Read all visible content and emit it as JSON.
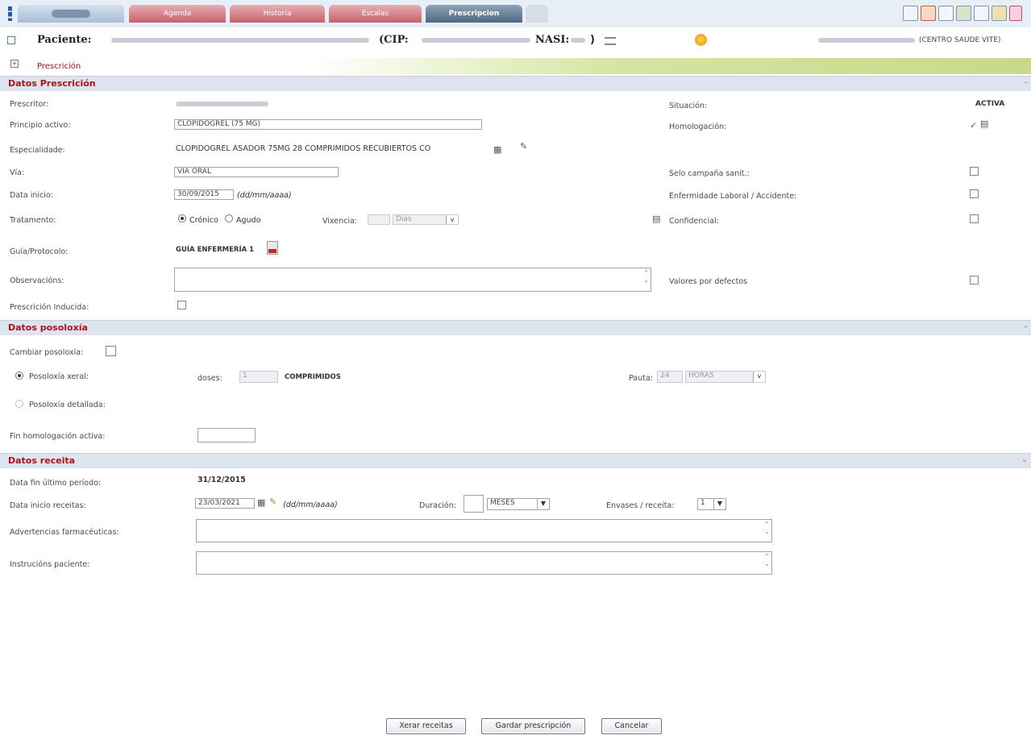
{
  "topbar": {
    "tabs": [
      {
        "label": "Agenda"
      },
      {
        "label": "Historia"
      },
      {
        "label": "Escalas"
      },
      {
        "label": "Prescripcion"
      }
    ]
  },
  "patient": {
    "label": "Paciente:",
    "cip_label": "(CIP:",
    "nasi_label": "NASI:",
    "close_paren": ")",
    "centre": "(CENTRO SAUDE VITE)"
  },
  "page_title": "Prescrición",
  "datos_prescricion": {
    "header": "Datos Prescrición",
    "prescritor_label": "Prescritor:",
    "situacion_label": "Situación:",
    "situacion_value": "ACTIVA",
    "principio_label": "Principio activo:",
    "principio_value": "CLOPIDOGREL (75 MG)",
    "homologacion_label": "Homologación:",
    "especialidade_label": "Especialidade:",
    "especialidade_value": "CLOPIDOGREL ASADOR 75MG 28 COMPRIMIDOS RECUBIERTOS CO",
    "via_label": "Vía:",
    "via_value": "VÍA ORAL",
    "selo_label": "Selo campaña sanit.:",
    "data_inicio_label": "Data inicio:",
    "data_inicio_value": "30/09/2015",
    "date_format_hint": "(dd/mm/aaaa)",
    "enfermidade_label": "Enfermidade Laboral / Accidente:",
    "tratamento_label": "Tratamento:",
    "cronico_label": "Crónico",
    "agudo_label": "Agudo",
    "vixencia_label": "Vixencia:",
    "vixencia_unit": "Días",
    "confidencial_label": "Confidencial:",
    "guia_label": "Guía/Protocolo:",
    "guia_value": "GUÍA ENFERMERÍA 1",
    "observacions_label": "Observacións:",
    "valores_label": "Valores por defectos",
    "inducida_label": "Prescrición Inducida:"
  },
  "datos_posoloxia": {
    "header": "Datos posoloxía",
    "cambiar_label": "Cambiar posoloxía:",
    "xeral_label": "Posoloxía xeral:",
    "doses_label": "doses:",
    "doses_value": "1",
    "doses_unit": "COMPRIMIDOS",
    "pauta_label": "Pauta:",
    "pauta_value": "24",
    "pauta_unit": "HORAS",
    "detallada_label": "Posoloxía detallada:",
    "fin_homolog_label": "Fin homologación activa:"
  },
  "datos_receita": {
    "header": "Datos receita",
    "data_fin_label": "Data fin último período:",
    "data_fin_value": "31/12/2015",
    "data_inicio_label": "Data inicio receitas:",
    "data_inicio_value": "23/03/2021",
    "date_format_hint": "(dd/mm/aaaa)",
    "duracion_label": "Duración:",
    "duracion_unit": "MESES",
    "envases_label": "Envases / receita:",
    "envases_value": "1",
    "advertencias_label": "Advertencias farmacéuticas:",
    "instrucions_label": "Instrucións paciente:"
  },
  "buttons": {
    "xerar": "Xerar receitas",
    "gardar": "Gardar prescripción",
    "cancelar": "Cancelar"
  }
}
